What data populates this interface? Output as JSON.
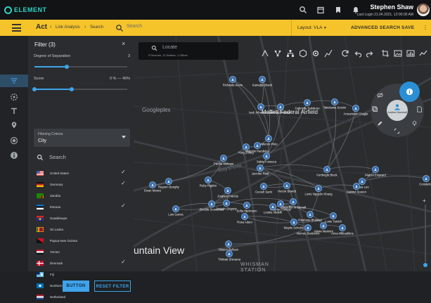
{
  "app": {
    "brand": "ELEMENT"
  },
  "user": {
    "name": "Stephen Shaw",
    "last_login": "Last Login 21.04.2021, 12:00:00 AM"
  },
  "actbar": {
    "title": "Act",
    "breadcrumbs": [
      "Link Analysis",
      "Search"
    ],
    "search_placeholder": "Search",
    "layout_label": "Layout: VLA",
    "advanced_search": "ADVANCED SEARCH",
    "save": "SAVE"
  },
  "filter": {
    "title": "Filter (3)",
    "degree_label": "Degree of Separation",
    "degree_value": "3",
    "degree_level": 0.35,
    "score_label": "Score",
    "score_value": "0 % — 40%",
    "score_range": [
      0,
      0.4
    ],
    "criteria_label": "Filtering Criteria",
    "criteria_value": "City",
    "search_placeholder": "Search",
    "countries": [
      {
        "name": "United States",
        "checked": true
      },
      {
        "name": "Germany",
        "checked": true
      },
      {
        "name": "Zambia",
        "checked": false
      },
      {
        "name": "Estonia",
        "checked": true
      },
      {
        "name": "Guadeloupe",
        "checked": false
      },
      {
        "name": "Sri Lanka",
        "checked": false
      },
      {
        "name": "Papua New Guinea",
        "checked": false
      },
      {
        "name": "Yemen",
        "checked": false
      },
      {
        "name": "Denmark",
        "checked": true
      },
      {
        "name": "Fiji",
        "checked": false
      },
      {
        "name": "Northern Mariana Islands",
        "checked": false
      },
      {
        "name": "Netherland",
        "checked": false
      }
    ],
    "button": "BUTTON",
    "reset": "RESET FILTER"
  },
  "map": {
    "locate_placeholder": "Locate",
    "locate_sub": "9 Persons, 11 Entities, 1 Officer",
    "labels": {
      "googleplex": "Googleplex",
      "moffett": "Moffett Federal Airfield",
      "mountain_view": "untain View",
      "whisman": "WHISMAN STATION",
      "bayshore": "Bayshore"
    },
    "radial_name": "Justine Marshall",
    "nodes": [
      "Richards Kevin",
      "Kamaljit Dhanir",
      "Isak Johannesson",
      "Ahmed Nasser",
      "Gabriella Tadokoro",
      "Takekawa Sorzini",
      "Armarinath Chagla",
      "Valentin Pinto",
      "Valentin Pandeleo",
      "King Zhang",
      "Pavilla Molvani",
      "Sabia Fonseca",
      "Jennifer Reid",
      "Forthright Block",
      "Marcel Engaard",
      "Lucas Lee",
      "Constelcio",
      "Rayann Bunghy",
      "Ewan Moses",
      "Ruby Rigden",
      "Hector Brandt",
      "Ceciah Sami",
      "Lunie Nguyên Khang",
      "Gabriel Souren",
      "Jorgiam Francis",
      "Joseph Grigorty",
      "Nasseffer Al Moradi",
      "Vicente Cornejo",
      "Ihirabusa Bhashid",
      "Luis Garcia",
      "Zinelda Scandross",
      "Sofia Hartmann",
      "Louise Abdelk",
      "Lonie Tambh",
      "Mayke Schulze",
      "Rosa Adam",
      "Akimou Bantonne",
      "Glasco Pellean",
      "Thilivati Shinuma",
      "Adwin Marinini",
      "Anna Milleaditine"
    ]
  }
}
